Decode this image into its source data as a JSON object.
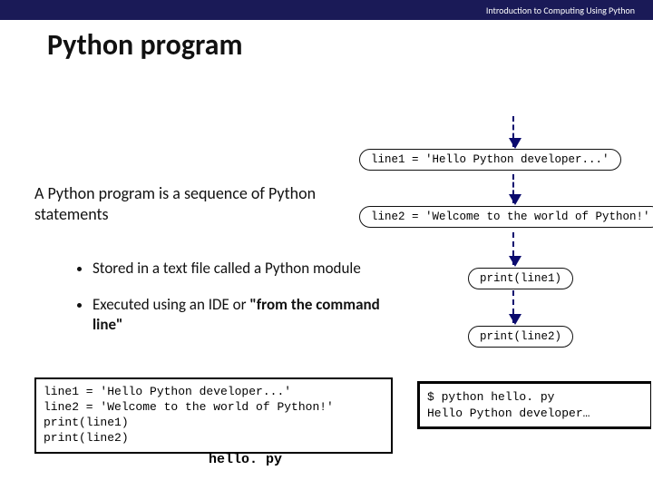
{
  "header": "Introduction to Computing Using Python",
  "title": "Python program",
  "lead": "A Python program is a sequence of Python statements",
  "bullet1": "Stored in a text file called a Python module",
  "bullet2_pre": "Executed using an IDE or ",
  "bullet2_em": "\"from the command line\"",
  "flow": {
    "line1": "line1 = 'Hello Python developer...'",
    "line2": "line2 = 'Welcome to the world of Python!'",
    "line3": "print(line1)",
    "line4": "print(line2)"
  },
  "program": {
    "l1": "line1 = 'Hello Python developer...'",
    "l2": "line2 = 'Welcome to the world of Python!'",
    "l3": "print(line1)",
    "l4": "print(line2)"
  },
  "program_label": "hello. py",
  "output": {
    "l1": "$ python hello. py",
    "l2": "Hello Python developer…"
  }
}
